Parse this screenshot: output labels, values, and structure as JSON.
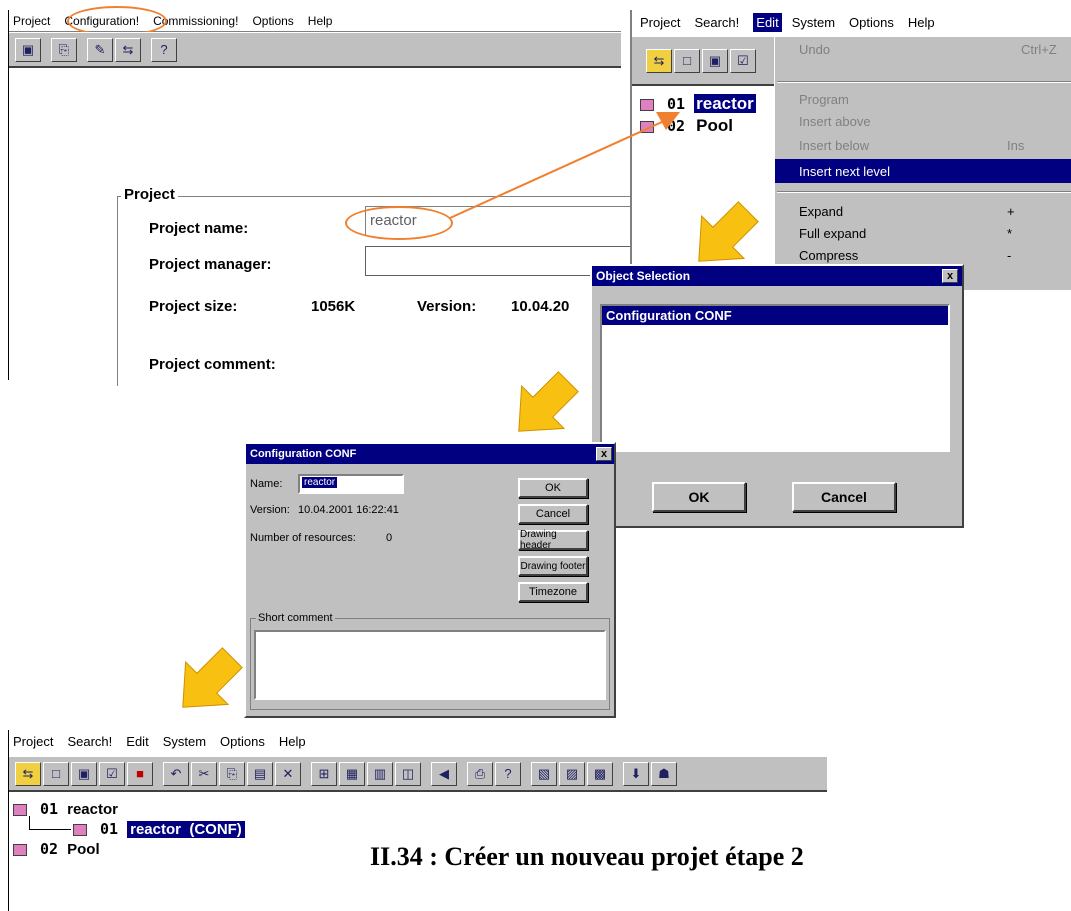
{
  "topleft": {
    "menu": [
      "Project",
      "Configuration!",
      "Commissioning!",
      "Options",
      "Help"
    ],
    "project_group_label": "Project",
    "project_name_label": "Project name:",
    "project_name_value": "reactor",
    "project_manager_label": "Project manager:",
    "project_size_label": "Project size:",
    "project_size_value": "1056K",
    "version_label": "Version:",
    "version_value": "10.04.20",
    "project_comment_label": "Project comment:"
  },
  "topright": {
    "menu": [
      "Project",
      "Search!",
      "Edit",
      "System",
      "Options",
      "Help"
    ],
    "tree": [
      {
        "num": "01",
        "name": "reactor"
      },
      {
        "num": "02",
        "name": "Pool"
      }
    ],
    "edit_menu": [
      {
        "label": "Undo",
        "shortcut": "Ctrl+Z",
        "disabled": true
      },
      {
        "label": "Program",
        "shortcut": "",
        "disabled": true
      },
      {
        "label": "Insert above",
        "shortcut": "",
        "disabled": true
      },
      {
        "label": "Insert below",
        "shortcut": "Ins",
        "disabled": true
      },
      {
        "label": "Insert next level",
        "shortcut": "",
        "selected": true
      },
      {
        "label": "Expand",
        "shortcut": "+"
      },
      {
        "label": "Full expand",
        "shortcut": "*"
      },
      {
        "label": "Compress",
        "shortcut": "-"
      }
    ]
  },
  "object_selection": {
    "title": "Object Selection",
    "close": "x",
    "items": [
      "Configuration CONF"
    ],
    "ok": "OK",
    "cancel": "Cancel"
  },
  "config_dialog": {
    "title": "Configuration CONF",
    "close": "x",
    "name_label": "Name:",
    "name_value": "reactor",
    "version_label": "Version:",
    "version_value": "10.04.2001 16:22:41",
    "resources_label": "Number of resources:",
    "resources_value": "0",
    "ok": "OK",
    "cancel": "Cancel",
    "drawing_header": "Drawing header",
    "drawing_footer": "Drawing footer",
    "timezone": "Timezone",
    "short_comment_label": "Short comment"
  },
  "bottom": {
    "menu": [
      "Project",
      "Search!",
      "Edit",
      "System",
      "Options",
      "Help"
    ],
    "tree_root": {
      "num": "01",
      "name": "reactor"
    },
    "tree_child": {
      "num": "01",
      "name": "reactor  (CONF)"
    },
    "tree_pool": {
      "num": "02",
      "name": "Pool"
    }
  },
  "caption": "II.34 : Créer un nouveau projet étape 2",
  "colors": {
    "selection": "#000080",
    "annotation": "#f08030",
    "arrow": "#f8c010",
    "face": "#c0c0c0"
  }
}
